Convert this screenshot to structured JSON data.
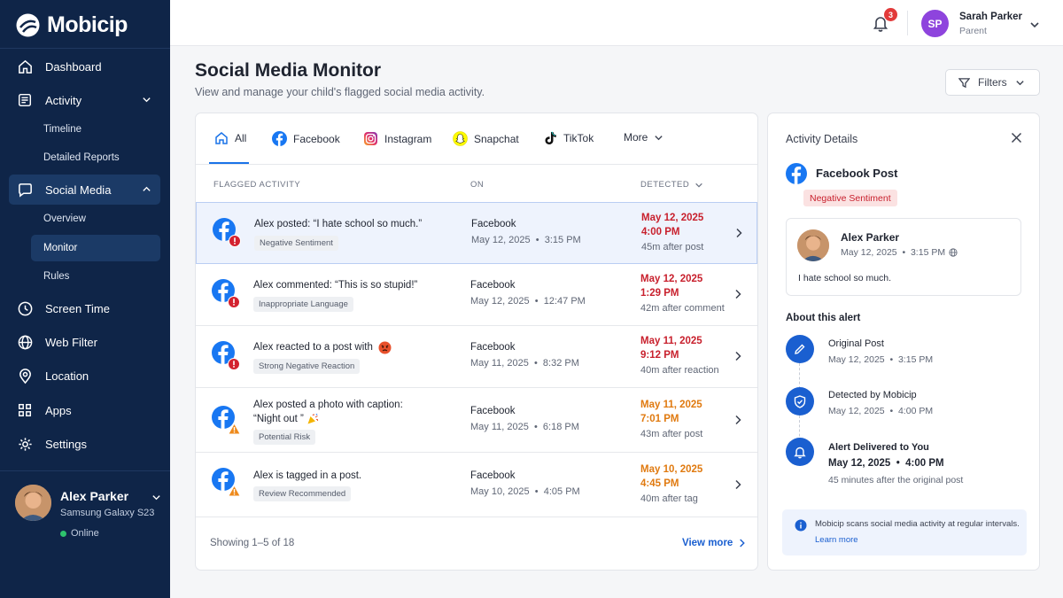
{
  "app": {
    "name": "Mobicip"
  },
  "nav": {
    "dashboard": "Dashboard",
    "activity": "Activity",
    "timeline": "Timeline",
    "detailed_reports": "Detailed Reports",
    "social_media": "Social Media",
    "overview": "Overview",
    "monitor": "Monitor",
    "rules": "Rules",
    "screen_time": "Screen Time",
    "web_filter": "Web Filter",
    "location": "Location",
    "apps": "Apps",
    "settings": "Settings"
  },
  "child": {
    "name": "Alex Parker",
    "device": "Samsung Galaxy S23",
    "status": "Online"
  },
  "topbar": {
    "notifications": "3",
    "initials": "SP",
    "user_name": "Sarah Parker",
    "user_role": "Parent"
  },
  "header": {
    "title": "Social Media Monitor",
    "subtitle": "View and manage your child's flagged social media activity.",
    "filters": "Filters"
  },
  "tabs": {
    "all": "All",
    "facebook": "Facebook",
    "instagram": "Instagram",
    "snapchat": "Snapchat",
    "tiktok": "TikTok",
    "more": "More"
  },
  "table": {
    "col_activity": "FLAGGED ACTIVITY",
    "col_on": "ON",
    "col_detected": "DETECTED",
    "rows": [
      {
        "text": "Alex posted: “I hate school so much.”",
        "tag": "Negative Sentiment",
        "source": "Facebook",
        "date": "May 12, 2025  •  3:15 PM",
        "det_date": "May 12, 2025",
        "det_time": "4:00 PM",
        "after": "45m after post",
        "severity": "high"
      },
      {
        "text": "Alex commented: “This is so stupid!”",
        "tag": "Inappropriate Language",
        "source": "Facebook",
        "date": "May 12, 2025  •  12:47 PM",
        "det_date": "May 12, 2025",
        "det_time": "1:29 PM",
        "after": "42m after comment",
        "severity": "high"
      },
      {
        "text": "Alex reacted to a post with",
        "tag": "Strong Negative Reaction",
        "source": "Facebook",
        "date": "May 11, 2025  •  8:32 PM",
        "det_date": "May 11, 2025",
        "det_time": "9:12 PM",
        "after": "40m after reaction",
        "severity": "high"
      },
      {
        "text": "Alex posted a photo with caption:",
        "text2": "“Night out ”",
        "tag": "Potential Risk",
        "source": "Facebook",
        "date": "May 11, 2025  •  6:18 PM",
        "det_date": "May 11, 2025",
        "det_time": "7:01 PM",
        "after": "43m after post",
        "severity": "medium"
      },
      {
        "text": "Alex is tagged in a post.",
        "tag": "Review Recommended",
        "source": "Facebook",
        "date": "May 10, 2025  •  4:05 PM",
        "det_date": "May 10, 2025",
        "det_time": "4:45 PM",
        "after": "40m after tag",
        "severity": "medium"
      }
    ],
    "showing": "Showing 1–5 of 18",
    "view_more": "View more"
  },
  "details": {
    "title": "Activity Details",
    "post_type": "Facebook Post",
    "tag": "Negative Sentiment",
    "author": "Alex Parker",
    "time": "May 12, 2025  •  3:15 PM",
    "text": "I hate school so much.",
    "about": "About this alert",
    "timeline": [
      {
        "title": "Original Post",
        "date": "May 12, 2025  •  3:15 PM"
      },
      {
        "title": "Detected by Mobicip",
        "date": "May 12, 2025  •  4:00 PM"
      },
      {
        "title": "Alert Delivered to You",
        "date": "May 12, 2025  •  4:00 PM",
        "note": "45 minutes after the original post"
      }
    ],
    "info": "Mobicip scans social media activity at regular intervals.",
    "learn_more": "Learn more"
  },
  "colors": {
    "sidebar": "#0f2548",
    "accent": "#1a73e8",
    "high": "#c8202d",
    "medium": "#e07a10"
  }
}
